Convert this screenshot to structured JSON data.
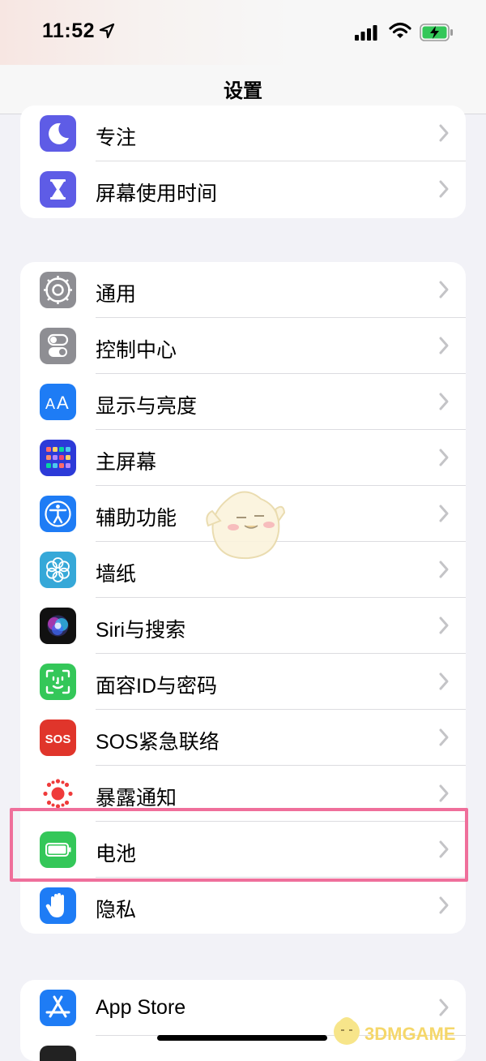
{
  "status_bar": {
    "time": "11:52",
    "icons": [
      "location-arrow-icon",
      "cellular-signal-icon",
      "wifi-icon",
      "battery-charging-icon"
    ]
  },
  "nav": {
    "title": "设置"
  },
  "groups": [
    {
      "rows": [
        {
          "label": "专注",
          "icon": "moon-icon",
          "color": "#5e5ce6"
        },
        {
          "label": "屏幕使用时间",
          "icon": "hourglass-icon",
          "color": "#5e5ce6"
        }
      ]
    },
    {
      "rows": [
        {
          "label": "通用",
          "icon": "gear-icon",
          "color": "#8e8e93"
        },
        {
          "label": "控制中心",
          "icon": "toggles-icon",
          "color": "#8e8e93"
        },
        {
          "label": "显示与亮度",
          "icon": "text-size-icon",
          "color": "#1e7cf5"
        },
        {
          "label": "主屏幕",
          "icon": "app-grid-icon",
          "color": "#2c3ad8"
        },
        {
          "label": "辅助功能",
          "icon": "accessibility-icon",
          "color": "#1e7cf5"
        },
        {
          "label": "墙纸",
          "icon": "flower-icon",
          "color": "#36a8d8"
        },
        {
          "label": "Siri与搜索",
          "icon": "siri-icon",
          "color": "#111111"
        },
        {
          "label": "面容ID与密码",
          "icon": "face-id-icon",
          "color": "#34c759"
        },
        {
          "label": "SOS紧急联络",
          "icon": "sos-icon",
          "color": "#e0352b",
          "icon_text": "SOS"
        },
        {
          "label": "暴露通知",
          "icon": "exposure-dots-icon",
          "color": "#ffffff"
        },
        {
          "label": "电池",
          "icon": "battery-icon",
          "color": "#34c759"
        },
        {
          "label": "隐私",
          "icon": "hand-icon",
          "color": "#1e7cf5"
        }
      ]
    },
    {
      "rows": [
        {
          "label": "App Store",
          "icon": "app-store-icon",
          "color": "#1e7cf5"
        }
      ]
    }
  ],
  "highlight_color": "#ef6f9b",
  "watermark": {
    "text": "3DMGAME"
  }
}
